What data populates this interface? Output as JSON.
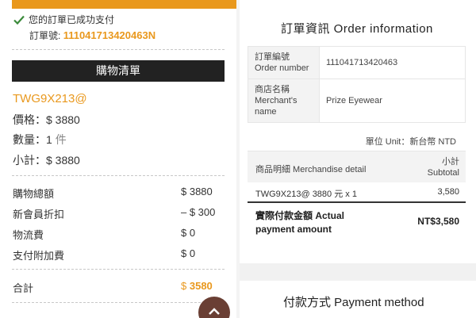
{
  "left": {
    "success_text": "您的訂單已成功支付",
    "order_no_label": "訂單號:",
    "order_no": "111041713420463N",
    "cart_header": "購物清單",
    "product_name": "TWG9X213@",
    "price_label": "價格：",
    "price_value": "$ 3880",
    "qty_label": "數量：",
    "qty_value": "1",
    "qty_unit": "件",
    "subtotal_label": "小計：",
    "subtotal_value": "$ 3880",
    "summary": [
      {
        "label": "購物總額",
        "value": "$ 3880"
      },
      {
        "label": "新會員折扣",
        "value": "– $ 300"
      },
      {
        "label": "物流費",
        "value": "$ 0"
      },
      {
        "label": "支付附加費",
        "value": "$ 0"
      }
    ],
    "total_label": "合計",
    "total_currency": "$",
    "total_amount": "3580",
    "accent_color": "#e9981d"
  },
  "right": {
    "info_title": "訂單資訊 Order information",
    "order_number_label": "訂單編號 Order number",
    "order_number_value": "111041713420463",
    "merchant_label": "商店名稱 Merchant's name",
    "merchant_value": "Prize Eyewear",
    "unit_line": "單位 Unit：新台幣 NTD",
    "merch_header": "商品明細 Merchandise detail",
    "subtotal_header_zh": "小計",
    "subtotal_header_en": "Subtotal",
    "item_desc": "TWG9X213@ 3880 元 x 1",
    "item_subtotal": "3,580",
    "actual_payment_label": "實際付款金額 Actual payment amount",
    "actual_payment_value": "NT$3,580",
    "payment_method_title": "付款方式 Payment method"
  },
  "icons": {
    "check": "check-icon",
    "up": "chevron-up-icon"
  }
}
